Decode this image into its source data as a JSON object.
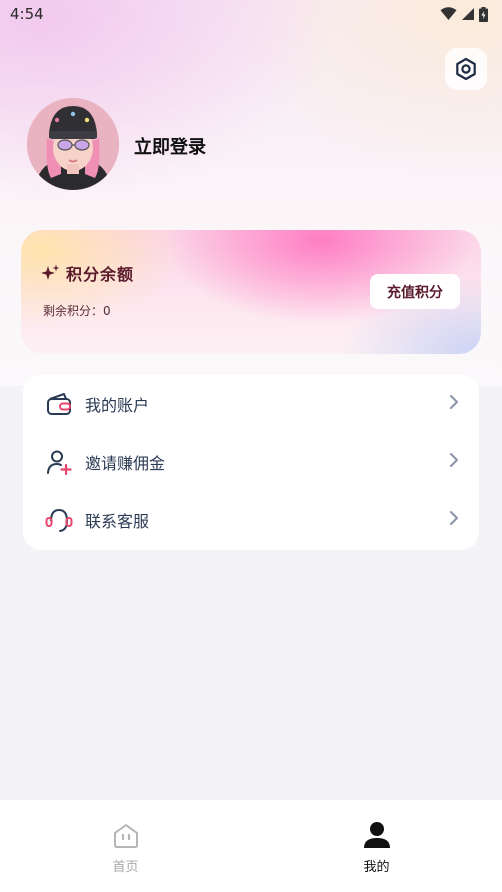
{
  "status_bar": {
    "time": "4:54"
  },
  "profile": {
    "login_label": "立即登录"
  },
  "points_card": {
    "title": "积分余额",
    "remaining_text": "剩余积分：0",
    "recharge_label": "充值积分"
  },
  "menu": {
    "items": [
      {
        "label": "我的账户",
        "icon": "wallet-icon"
      },
      {
        "label": "邀请赚佣金",
        "icon": "invite-user-icon"
      },
      {
        "label": "联系客服",
        "icon": "headset-icon"
      }
    ]
  },
  "tab_bar": {
    "tabs": [
      {
        "label": "首页",
        "icon": "home-icon",
        "active": false
      },
      {
        "label": "我的",
        "icon": "person-icon",
        "active": true
      }
    ]
  },
  "colors": {
    "accent_dark": "#5a1a2c",
    "menu_text": "#2b3a55",
    "icon_pink": "#e8456e"
  }
}
